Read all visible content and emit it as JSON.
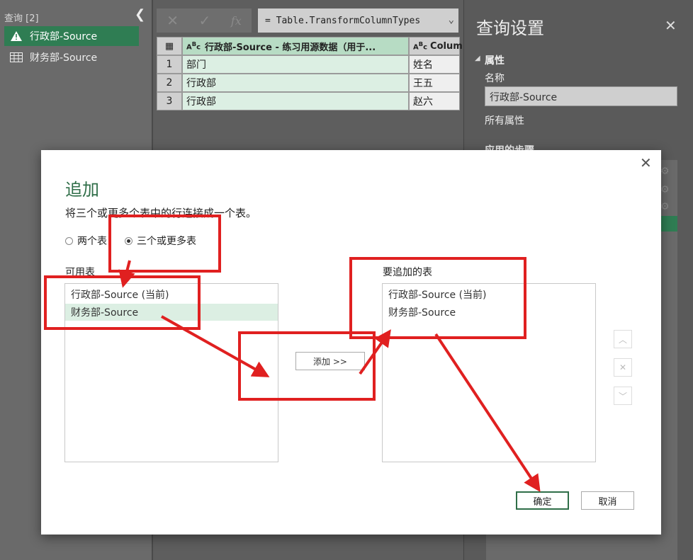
{
  "queries": {
    "header": "查询 [2]",
    "items": [
      {
        "label": "行政部-Source",
        "icon": "warning-icon"
      },
      {
        "label": "财务部-Source",
        "icon": "table-icon"
      }
    ]
  },
  "formula_bar": {
    "cancel": "✕",
    "confirm": "✓",
    "fx": "fx",
    "text": "= Table.TransformColumnTypes"
  },
  "grid": {
    "headers": [
      "行政部-Source - 练习用源数据（用于...",
      "Colum"
    ],
    "rows": [
      {
        "n": "1",
        "a": "部门",
        "b": "姓名"
      },
      {
        "n": "2",
        "a": "行政部",
        "b": "王五"
      },
      {
        "n": "3",
        "a": "行政部",
        "b": "赵六"
      }
    ]
  },
  "settings": {
    "title": "查询设置",
    "properties": "属性",
    "name_label": "名称",
    "name_value": "行政部-Source",
    "all_properties": "所有属性",
    "applied_steps": "应用的步骤"
  },
  "dialog": {
    "title": "追加",
    "description": "将三个或更多个表中的行连接成一个表。",
    "radio_two": "两个表",
    "radio_three": "三个或更多表",
    "available_label": "可用表",
    "append_label": "要追加的表",
    "available": [
      "行政部-Source (当前)",
      "财务部-Source"
    ],
    "to_append": [
      "行政部-Source (当前)",
      "财务部-Source"
    ],
    "add_button": "添加 >>",
    "ok": "确定",
    "cancel": "取消"
  },
  "colors": {
    "accent": "#2f7d53",
    "annotation": "#e02020"
  }
}
